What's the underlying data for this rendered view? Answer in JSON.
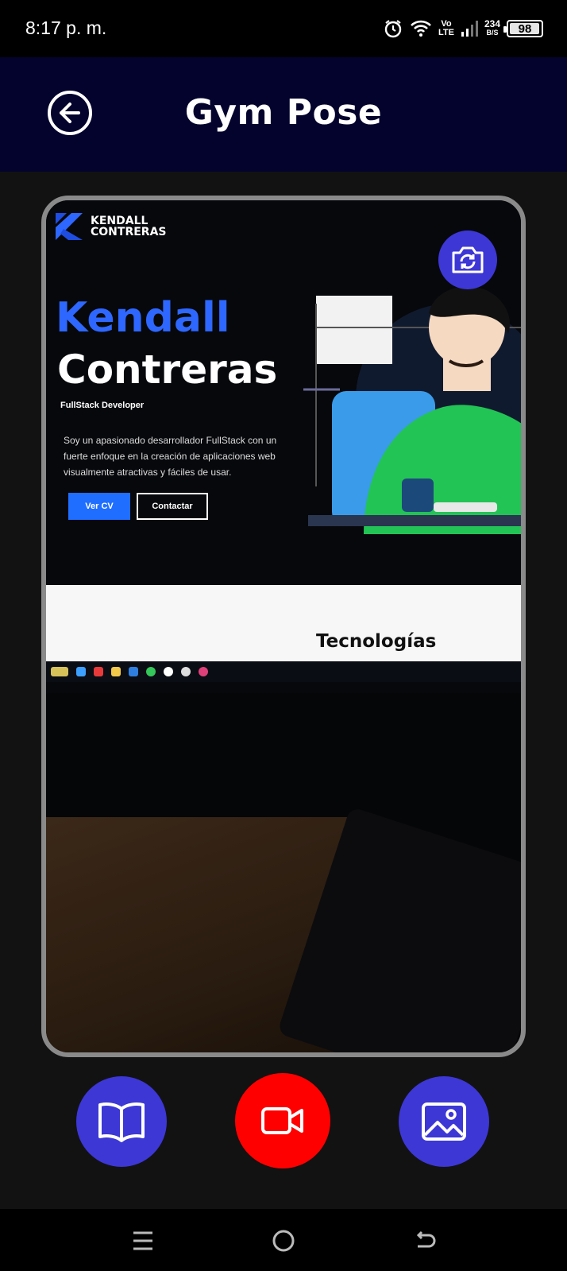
{
  "status_bar": {
    "time": "8:17 p. m.",
    "network_top": "Vo",
    "network_bottom": "LTE",
    "speed_value": "234",
    "speed_unit": "B/S",
    "battery": "98",
    "icons": [
      "alarm-icon",
      "wifi-icon",
      "signal-icon",
      "battery-icon"
    ]
  },
  "app_bar": {
    "title": "Gym Pose",
    "back_icon": "arrow-left-circle-icon"
  },
  "camera_preview": {
    "switch_camera_icon": "camera-switch-icon",
    "scene": {
      "logo_line1": "KENDALL",
      "logo_line2": "CONTRERAS",
      "hero_first": "Kendall",
      "hero_last": "Contreras",
      "role": "FullStack Developer",
      "description": "Soy un apasionado desarrollador FullStack con un fuerte enfoque en la creación de aplicaciones web visualmente atractivas y fáciles de usar.",
      "button_cv": "Ver CV",
      "button_contact": "Contactar",
      "section_title": "Tecnologías"
    }
  },
  "controls": {
    "guide_icon": "open-book-icon",
    "record_icon": "video-camera-icon",
    "gallery_icon": "image-icon",
    "accent_color": "#3d37d6",
    "record_color": "#ff0000"
  },
  "nav_bar": {
    "icons": [
      "menu-icon",
      "home-icon",
      "back-icon"
    ]
  }
}
